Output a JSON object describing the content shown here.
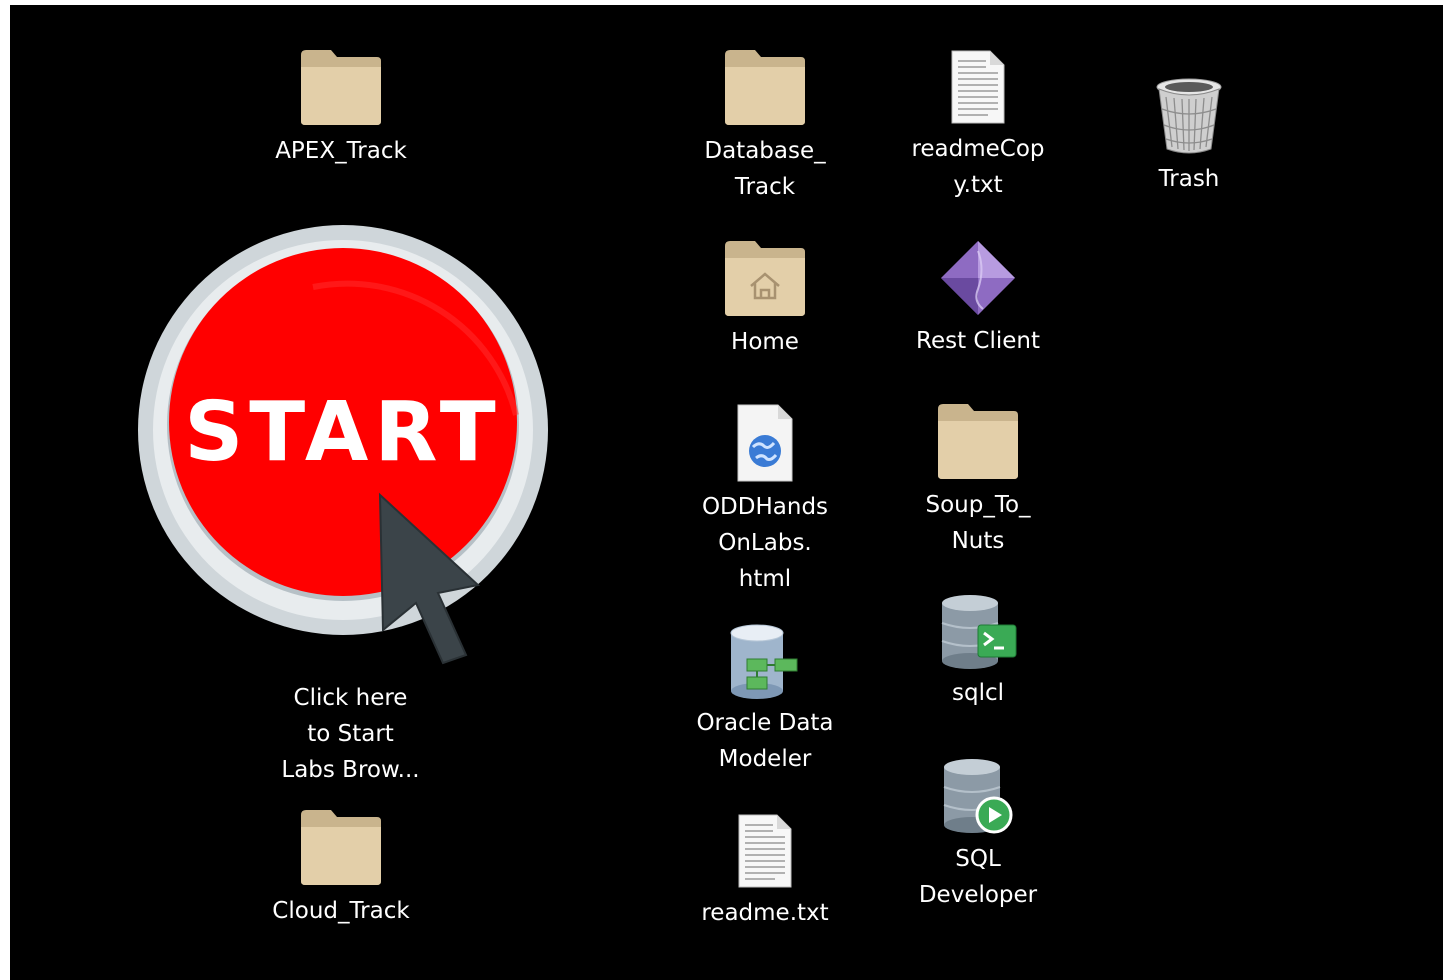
{
  "desktop": {
    "background": "#000000",
    "start_launcher": {
      "button_text": "START",
      "label": "Click here\nto Start\nLabs Brow..."
    },
    "icons": [
      {
        "id": "apex-track",
        "label": "APEX_Track",
        "icon": "folder-icon"
      },
      {
        "id": "cloud-track",
        "label": "Cloud_Track",
        "icon": "folder-icon"
      },
      {
        "id": "database-track",
        "label": "Database_\nTrack",
        "icon": "folder-icon"
      },
      {
        "id": "home",
        "label": "Home",
        "icon": "home-folder-icon"
      },
      {
        "id": "oddhandsonlabs",
        "label": "ODDHands\nOnLabs.\nhtml",
        "icon": "html-file-icon"
      },
      {
        "id": "oracle-data-modeler",
        "label": "Oracle Data\nModeler",
        "icon": "data-modeler-icon"
      },
      {
        "id": "readme",
        "label": "readme.txt",
        "icon": "text-file-icon"
      },
      {
        "id": "readme-copy",
        "label": "readmeCop\ny.txt",
        "icon": "text-file-icon"
      },
      {
        "id": "rest-client",
        "label": "Rest Client",
        "icon": "rest-client-icon"
      },
      {
        "id": "soup-to-nuts",
        "label": "Soup_To_\nNuts",
        "icon": "folder-icon"
      },
      {
        "id": "sqlcl",
        "label": "sqlcl",
        "icon": "sqlcl-icon"
      },
      {
        "id": "sql-developer",
        "label": "SQL\nDeveloper",
        "icon": "sql-developer-icon"
      },
      {
        "id": "trash",
        "label": "Trash",
        "icon": "trash-icon"
      }
    ],
    "colors": {
      "folder": "#e3cfa9",
      "start_red": "#ff0000",
      "start_ring": "#cfd6da"
    }
  }
}
